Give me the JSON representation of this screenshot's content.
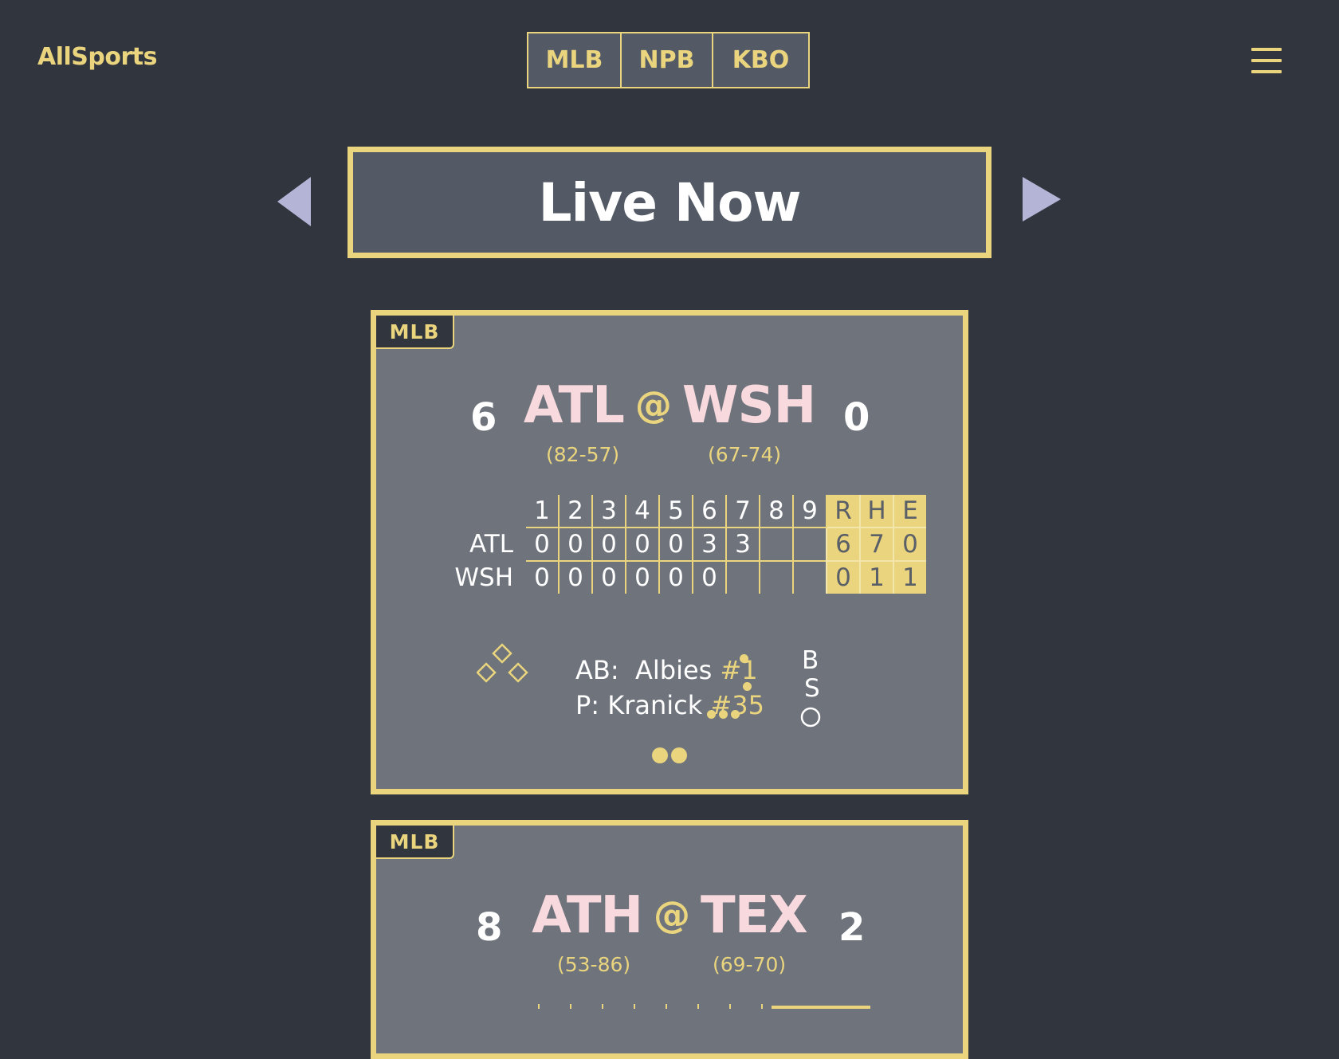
{
  "header": {
    "logo": "AllSports",
    "tabs": [
      "MLB",
      "NPB",
      "KBO"
    ],
    "menu_icon": "hamburger-menu-icon"
  },
  "section": {
    "title": "Live Now",
    "prev_icon": "triangle-left-icon",
    "next_icon": "triangle-right-icon"
  },
  "colors": {
    "background": "#30353e",
    "accent": "#ead57e",
    "card": "#6e737c",
    "team": "#f8d9de",
    "arrow": "#b4b5d6"
  },
  "games": [
    {
      "league": "MLB",
      "away": {
        "abbr": "ATL",
        "score": "6",
        "record": "(82-57)"
      },
      "home": {
        "abbr": "WSH",
        "score": "0",
        "record": "(67-74)"
      },
      "at": "@",
      "linescore": {
        "innings": [
          "1",
          "2",
          "3",
          "4",
          "5",
          "6",
          "7",
          "8",
          "9"
        ],
        "totals_headers": [
          "R",
          "H",
          "E"
        ],
        "rows": [
          {
            "team": "ATL",
            "innings": [
              "0",
              "0",
              "0",
              "0",
              "0",
              "3",
              "3",
              "",
              ""
            ],
            "totals": [
              "6",
              "7",
              "0"
            ]
          },
          {
            "team": "WSH",
            "innings": [
              "0",
              "0",
              "0",
              "0",
              "0",
              "0",
              "",
              "",
              ""
            ],
            "totals": [
              "0",
              "1",
              "1"
            ]
          }
        ]
      },
      "bases_icon": "diamond-bases-icon",
      "at_bat": {
        "label": "AB:",
        "name": "Albies",
        "number": "#1"
      },
      "pitcher": {
        "label": "P:",
        "name": "Kranick",
        "number": "#35"
      },
      "count": {
        "balls": 1,
        "strikes": 1,
        "outs": 3,
        "balls_label": "B",
        "strikes_label": "S",
        "outs_label": "O"
      },
      "pager": 2
    },
    {
      "league": "MLB",
      "away": {
        "abbr": "ATH",
        "score": "8",
        "record": "(53-86)"
      },
      "home": {
        "abbr": "TEX",
        "score": "2",
        "record": "(69-70)"
      },
      "at": "@"
    }
  ]
}
